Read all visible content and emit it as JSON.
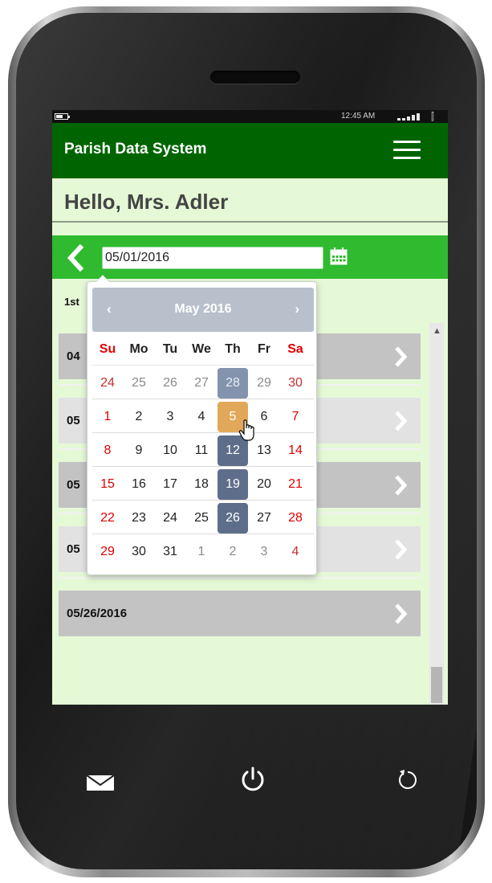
{
  "status_bar": {
    "time": "12:45 AM"
  },
  "app": {
    "title": "Parish Data System",
    "greeting": "Hello, Mrs. Adler"
  },
  "date_nav": {
    "date_value": "05/01/2016",
    "week_label": "1st"
  },
  "list": {
    "items": [
      {
        "label": "04"
      },
      {
        "label": "05"
      },
      {
        "label": "05"
      },
      {
        "label": "05"
      },
      {
        "label": "05/26/2016"
      }
    ]
  },
  "datepicker": {
    "title": "May 2016",
    "prev": "‹",
    "next": "›",
    "weekdays": [
      "Su",
      "Mo",
      "Tu",
      "We",
      "Th",
      "Fr",
      "Sa"
    ],
    "weeks": [
      [
        "24",
        "25",
        "26",
        "27",
        "28",
        "29",
        "30"
      ],
      [
        "1",
        "2",
        "3",
        "4",
        "5",
        "6",
        "7"
      ],
      [
        "8",
        "9",
        "10",
        "11",
        "12",
        "13",
        "14"
      ],
      [
        "15",
        "16",
        "17",
        "18",
        "19",
        "20",
        "21"
      ],
      [
        "22",
        "23",
        "24",
        "25",
        "26",
        "27",
        "28"
      ],
      [
        "29",
        "30",
        "31",
        "1",
        "2",
        "3",
        "4"
      ]
    ],
    "highlighted_weekday": "Th",
    "today": "5"
  },
  "colors": {
    "app_bar": "#006500",
    "date_bar": "#2fba2f",
    "screen_bg": "#e5f9d6",
    "weekend": "#e00000",
    "thursday_highlight": "#5e6e8a",
    "today_highlight": "#e2a85a"
  },
  "icons": {
    "menu": "hamburger-icon",
    "back": "chevron-left-icon",
    "calendar": "calendar-icon",
    "list_chevron": "chevron-right-icon",
    "mail": "mail-icon",
    "power": "power-icon",
    "back_hw": "rotate-icon"
  }
}
